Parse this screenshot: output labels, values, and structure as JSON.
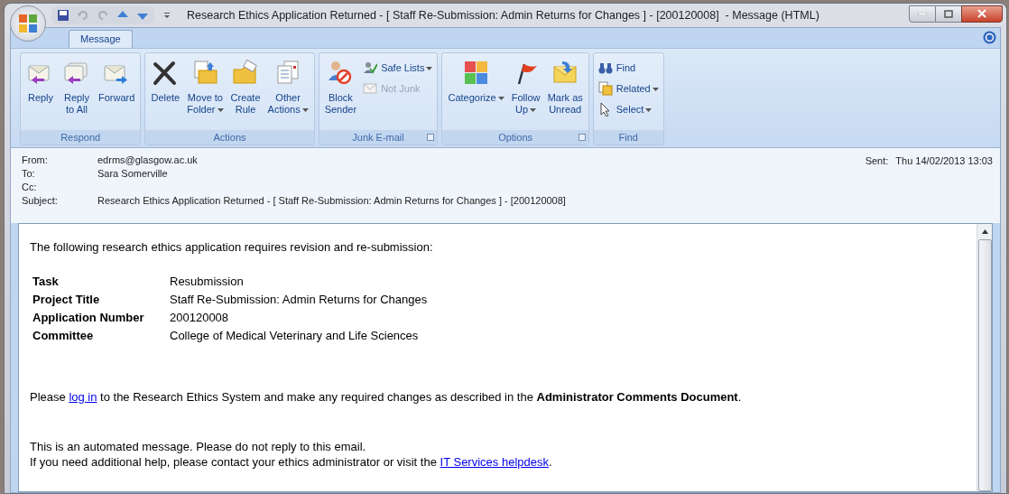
{
  "window": {
    "title": "Research Ethics Application Returned - [ Staff Re-Submission: Admin Returns for Changes ] - [200120008]  - Message (HTML)"
  },
  "tabs": [
    {
      "label": "Message",
      "selected": true
    }
  ],
  "ribbon": [
    {
      "label": "Respond",
      "launcher": false,
      "buttons": [
        {
          "label": "Reply",
          "kind": "large",
          "dropdown": false,
          "disabled": false
        },
        {
          "label": "Reply\nto All",
          "kind": "large",
          "dropdown": false,
          "disabled": false
        },
        {
          "label": "Forward",
          "kind": "large",
          "dropdown": false,
          "disabled": false
        }
      ]
    },
    {
      "label": "Actions",
      "launcher": false,
      "buttons": [
        {
          "label": "Delete",
          "kind": "large",
          "dropdown": false,
          "disabled": false
        },
        {
          "label": "Move to\nFolder",
          "kind": "large",
          "dropdown": true,
          "disabled": false
        },
        {
          "label": "Create\nRule",
          "kind": "large",
          "dropdown": false,
          "disabled": false
        },
        {
          "label": "Other\nActions",
          "kind": "large",
          "dropdown": true,
          "disabled": false
        }
      ]
    },
    {
      "label": "Junk E-mail",
      "launcher": true,
      "buttons": [
        {
          "label": "Block\nSender",
          "kind": "large",
          "dropdown": false,
          "disabled": false
        },
        {
          "label": "Safe Lists",
          "kind": "small",
          "dropdown": true,
          "disabled": false
        },
        {
          "label": "Not Junk",
          "kind": "small",
          "dropdown": false,
          "disabled": true
        }
      ]
    },
    {
      "label": "Options",
      "launcher": true,
      "buttons": [
        {
          "label": "Categorize",
          "kind": "large",
          "dropdown": true,
          "disabled": false
        },
        {
          "label": "Follow\nUp",
          "kind": "large",
          "dropdown": true,
          "disabled": false
        },
        {
          "label": "Mark as\nUnread",
          "kind": "large",
          "dropdown": false,
          "disabled": false
        }
      ]
    },
    {
      "label": "Find",
      "launcher": false,
      "buttons": [
        {
          "label": "Find",
          "kind": "small",
          "dropdown": false,
          "disabled": false
        },
        {
          "label": "Related",
          "kind": "small",
          "dropdown": true,
          "disabled": false
        },
        {
          "label": "Select",
          "kind": "small",
          "dropdown": true,
          "disabled": false
        }
      ]
    }
  ],
  "header": {
    "fields": [
      {
        "label": "From:",
        "value": "edrms@glasgow.ac.uk"
      },
      {
        "label": "To:",
        "value": "Sara Somerville"
      },
      {
        "label": "Cc:"
      },
      {
        "label": "Subject:",
        "value": "Research Ethics Application Returned - [ Staff Re-Submission: Admin Returns for Changes ] - [200120008]"
      }
    ],
    "sent_label": "Sent:",
    "sent_value": "Thu 14/02/2013 13:03"
  },
  "body": {
    "intro": "The following research ethics application requires revision and re-submission:",
    "details": [
      {
        "label": "Task",
        "value": "Resubmission"
      },
      {
        "label": "Project Title",
        "value": "Staff Re-Submission: Admin Returns for Changes"
      },
      {
        "label": "Application Number",
        "value": "200120008"
      },
      {
        "label": "Committee",
        "value": "College of Medical Veterinary and Life Sciences"
      }
    ],
    "instruction": [
      {
        "text": "Please "
      },
      {
        "kind": "link",
        "text": "log in"
      },
      {
        "text": " to the Research Ethics System and make any required changes as described in the **Administrator Comments Document**."
      }
    ],
    "footer": [
      [
        {
          "text": "This is an automated message. Please do not reply to this email."
        }
      ],
      [
        {
          "text": "If you need additional help, please contact your ethics administrator or visit the "
        },
        {
          "kind": "link",
          "text": "IT Services helpdesk"
        },
        {
          "text": "."
        }
      ]
    ]
  }
}
